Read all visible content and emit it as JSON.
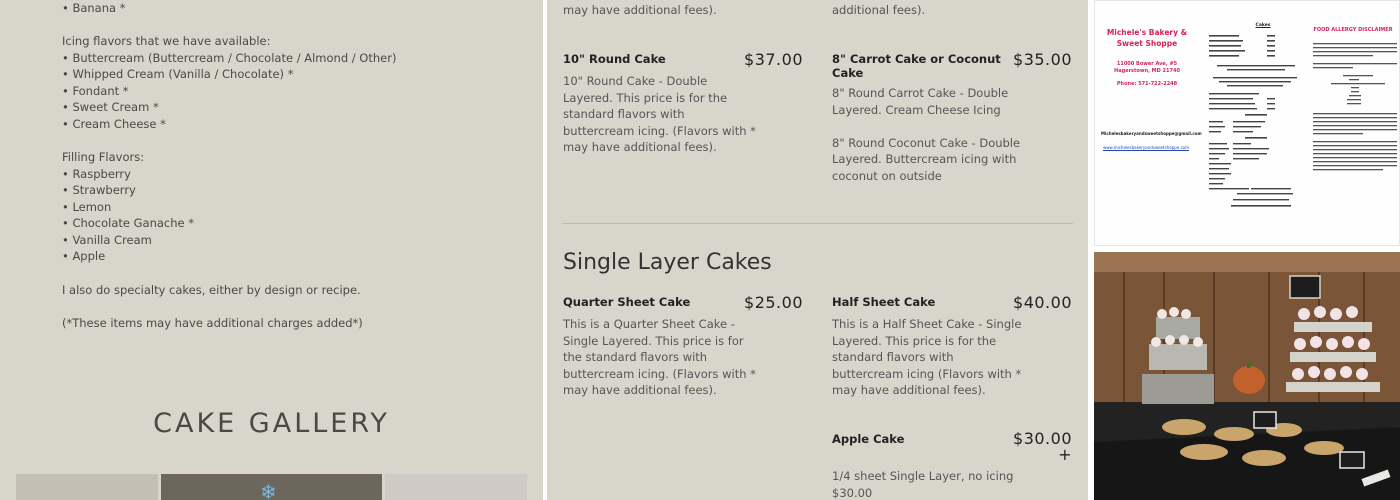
{
  "left": {
    "lines": [
      "• Banana *",
      "Icing flavors that we have available:",
      "• Buttercream (Buttercream / Chocolate / Almond / Other)",
      "• Whipped Cream (Vanilla / Chocolate) *",
      "• Fondant *",
      "• Sweet Cream *",
      "• Cream Cheese *",
      "Filling Flavors:",
      "• Raspberry",
      "• Strawberry",
      "• Lemon",
      "• Chocolate Ganache *",
      "• Vanilla Cream",
      "• Apple",
      "I also do specialty cakes, either by design or recipe.",
      "(*These items may have additional charges added*)"
    ],
    "gallery_title": "CAKE GALLERY"
  },
  "menu": {
    "top_left_tail": "may have additional fees).",
    "top_right_tail": "additional fees).",
    "items": [
      {
        "name": "10\" Round Cake",
        "price": "$37.00",
        "desc": "10\" Round Cake - Double\nLayered. This price is for the\nstandard flavors with\nbuttercream icing.  (Flavors with *\nmay have additional fees)."
      },
      {
        "name": "8\" Carrot Cake or Coconut\nCake",
        "price": "$35.00",
        "desc": "8\" Round Carrot Cake - Double\nLayered. Cream Cheese Icing\n\n8\" Round Coconut Cake - Double\nLayered.  Buttercream icing with\ncoconut on outside"
      },
      {
        "name": "Quarter Sheet Cake",
        "price": "$25.00",
        "desc": "This is a Quarter Sheet Cake -\nSingle Layered.  This price is for\nthe standard flavors with\nbuttercream icing. (Flavors with *\nmay have additional fees)."
      },
      {
        "name": "Half Sheet Cake",
        "price": "$40.00",
        "desc": "This is a Half Sheet Cake - Single\nLayered.  This price is for the\nstandard flavors with\nbuttercream icing (Flavors with *\nmay have additional fees)."
      },
      {
        "name": "Apple Cake",
        "price": "$30.00\n+",
        "desc": "1/4 sheet Single Layer, no icing\n$30.00"
      }
    ],
    "section_title": "Single Layer Cakes"
  },
  "flyer": {
    "shop_name": "Michele's Bakery &\nSweet Shoppe",
    "address": "11000 Bower Ave, #5\nHagerstown, MD 21740",
    "phone": "Phone: 571-722-2248",
    "email": "Michelesbakeryandsweetshoppe@gmail.com",
    "website": "www.michelesbakeryandsweetshoppe.com",
    "cakes_heading": "Cakes",
    "allergy_heading": "FOOD ALLERGY DISCLAIMER"
  },
  "colors": {
    "panel_bg": "#d8d5cb",
    "accent_red": "#d4255b",
    "link_blue": "#2247b5"
  }
}
